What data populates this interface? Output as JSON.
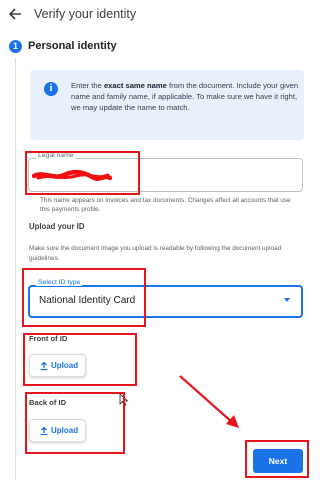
{
  "header": {
    "title": "Verify your identity",
    "back_icon": "arrow-left-icon"
  },
  "step": {
    "number": "1",
    "title": "Personal identity"
  },
  "info": {
    "text_before": "Enter the ",
    "text_bold": "exact same name",
    "text_after": " from the document. Include your given name and family name, if applicable. To make sure we have it right, we may update the name to match."
  },
  "legal_name": {
    "label": "Legal name",
    "helper": "This name appears on invoices and tax documents. Changes affect all accounts that use this payments profile."
  },
  "upload": {
    "title": "Upload your ID",
    "description": "Make sure the document image you upload is readable by following the document upload guidelines."
  },
  "id_type": {
    "label": "Select ID type",
    "value": "National Identity Card"
  },
  "front": {
    "label": "Front of ID",
    "button": "Upload"
  },
  "back": {
    "label": "Back of ID",
    "button": "Upload"
  },
  "next_button": "Next",
  "colors": {
    "accent": "#1a73e8",
    "annotation": "#e8141b",
    "info_background": "#e8f0fe",
    "redaction": "#f01010"
  }
}
